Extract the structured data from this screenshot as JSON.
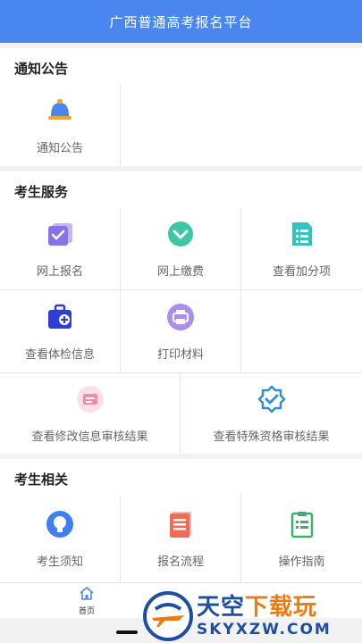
{
  "header": {
    "title": "广西普通高考报名平台"
  },
  "sections": {
    "notice": {
      "title": "通知公告",
      "items": [
        {
          "label": "通知公告",
          "icon": "bell-icon"
        }
      ]
    },
    "services": {
      "title": "考生服务",
      "items": [
        {
          "label": "网上报名",
          "icon": "registration-icon"
        },
        {
          "label": "网上缴费",
          "icon": "payment-icon"
        },
        {
          "label": "查看加分项",
          "icon": "bonus-points-icon"
        },
        {
          "label": "查看体检信息",
          "icon": "medical-kit-icon"
        },
        {
          "label": "打印材料",
          "icon": "printer-icon"
        },
        {
          "label": "查看修改信息审核结果",
          "icon": "edit-review-icon"
        },
        {
          "label": "查看特殊资格审核结果",
          "icon": "verified-badge-icon"
        }
      ]
    },
    "related": {
      "title": "考生相关",
      "items": [
        {
          "label": "考生须知",
          "icon": "bulb-icon"
        },
        {
          "label": "报名流程",
          "icon": "process-document-icon"
        },
        {
          "label": "操作指南",
          "icon": "guide-clipboard-icon"
        }
      ]
    }
  },
  "tabbar": {
    "home_label": "首页"
  },
  "watermark": {
    "line1_a": "天空",
    "line1_b": "下载玩",
    "line2": "SKYXZW.COM"
  },
  "colors": {
    "primary": "#4a86f0",
    "text": "#666666",
    "divider": "#e6e6e6"
  }
}
